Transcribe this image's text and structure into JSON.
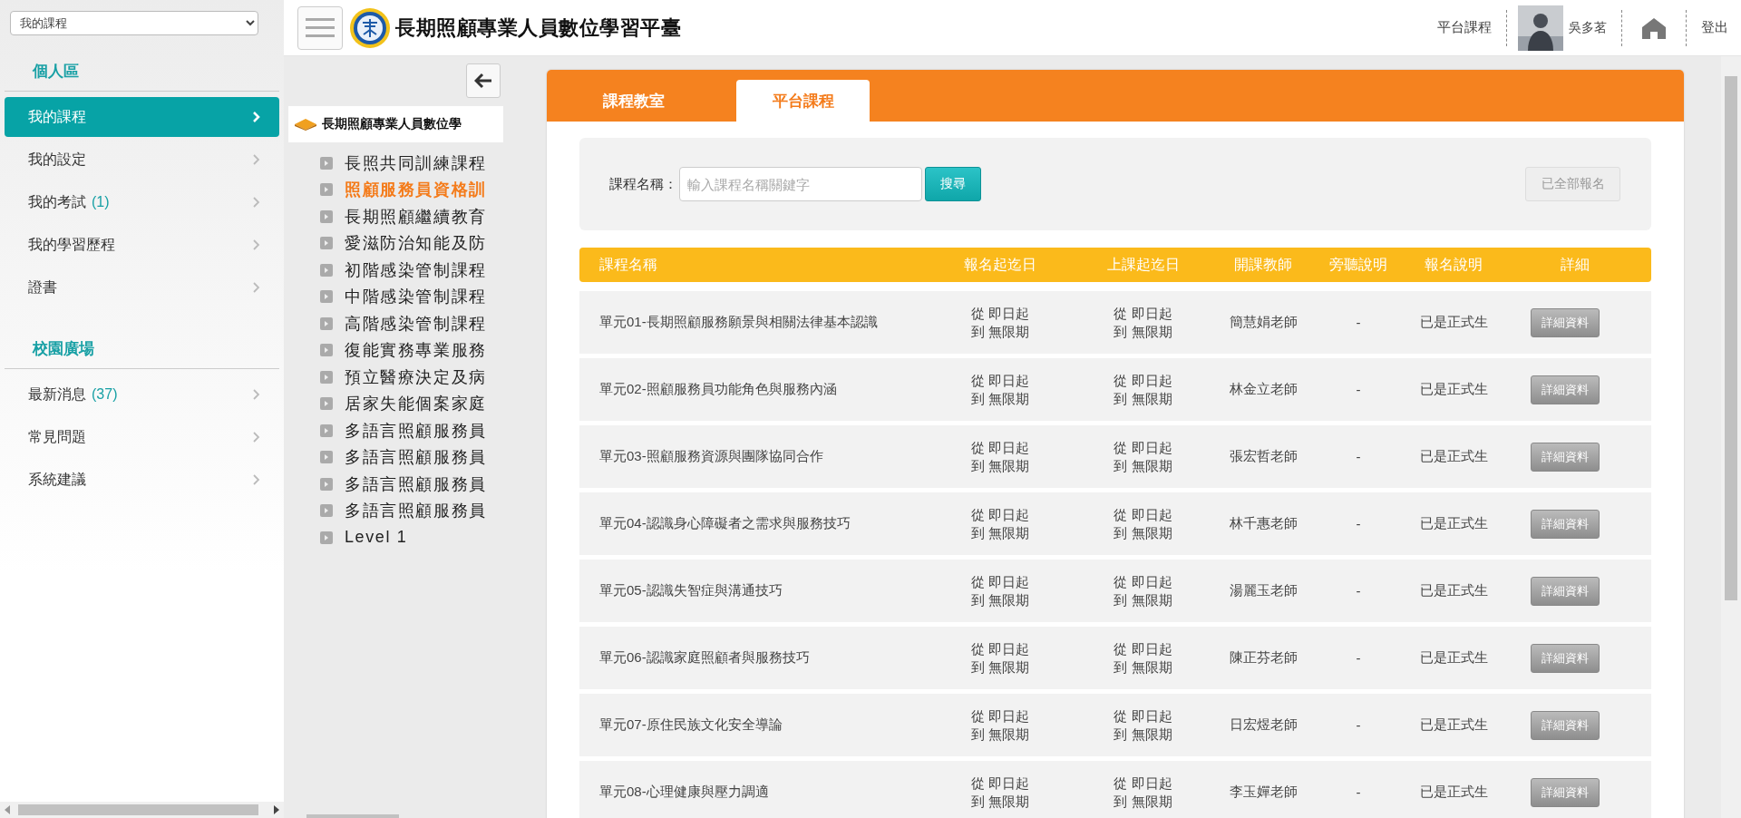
{
  "sidebar": {
    "select": {
      "value": "我的課程"
    },
    "sections": [
      {
        "title": "個人區",
        "items": [
          {
            "label": "我的課程",
            "selected": true
          },
          {
            "label": "我的設定",
            "selected": false
          },
          {
            "label": "我的考試",
            "count": "(1)",
            "selected": false
          },
          {
            "label": "我的學習歷程",
            "selected": false
          },
          {
            "label": "證書",
            "selected": false
          }
        ]
      },
      {
        "title": "校園廣場",
        "items": [
          {
            "label": "最新消息",
            "count": "(37)",
            "selected": false
          },
          {
            "label": "常見問題",
            "selected": false
          },
          {
            "label": "系統建議",
            "selected": false
          }
        ]
      }
    ]
  },
  "header": {
    "title": "長期照顧專業人員數位學習平臺",
    "links": [
      "平台課程"
    ],
    "user": "吳多茗",
    "logout": "登出"
  },
  "tree": {
    "root": {
      "label": "長期照顧專業人員數位學",
      "children": [
        {
          "label": "長照共同訓練課程",
          "selected": false
        },
        {
          "label": "照顧服務員資格訓",
          "selected": true
        },
        {
          "label": "長期照顧繼續教育",
          "selected": false
        },
        {
          "label": "愛滋防治知能及防",
          "selected": false
        },
        {
          "label": "初階感染管制課程",
          "selected": false
        },
        {
          "label": "中階感染管制課程",
          "selected": false
        },
        {
          "label": "高階感染管制課程",
          "selected": false
        },
        {
          "label": "復能實務專業服務",
          "selected": false
        },
        {
          "label": "預立醫療決定及病",
          "selected": false
        },
        {
          "label": "居家失能個案家庭",
          "selected": false
        },
        {
          "label": "多語言照顧服務員",
          "selected": false
        },
        {
          "label": "多語言照顧服務員",
          "selected": false
        },
        {
          "label": "多語言照顧服務員",
          "selected": false
        },
        {
          "label": "多語言照顧服務員",
          "selected": false
        },
        {
          "label": "Level 1",
          "selected": false
        }
      ]
    }
  },
  "tabs": [
    {
      "label": "課程教室",
      "selected": false
    },
    {
      "label": "平台課程",
      "selected": true
    }
  ],
  "search": {
    "label": "課程名稱：",
    "placeholder": "輸入課程名稱關鍵字",
    "button": "搜尋",
    "enroll_all": {
      "label": "已全部報名",
      "disabled": true
    }
  },
  "table": {
    "columns": [
      "課程名稱",
      "報名起迄日",
      "上課起迄日",
      "開課教師",
      "旁聽說明",
      "報名說明",
      "詳細"
    ],
    "rows": [
      {
        "name": "單元01-長期照顧服務願景與相關法律基本認識",
        "enroll": [
          "從 即日起",
          "到 無限期"
        ],
        "class": [
          "從 即日起",
          "到 無限期"
        ],
        "teacher": "簡慧娟老師",
        "audit": "-",
        "note": "已是正式生",
        "button": "詳細資料"
      },
      {
        "name": "單元02-照顧服務員功能角色與服務內涵",
        "enroll": [
          "從 即日起",
          "到 無限期"
        ],
        "class": [
          "從 即日起",
          "到 無限期"
        ],
        "teacher": "林金立老師",
        "audit": "-",
        "note": "已是正式生",
        "button": "詳細資料"
      },
      {
        "name": "單元03-照顧服務資源與團隊協同合作",
        "enroll": [
          "從 即日起",
          "到 無限期"
        ],
        "class": [
          "從 即日起",
          "到 無限期"
        ],
        "teacher": "張宏哲老師",
        "audit": "-",
        "note": "已是正式生",
        "button": "詳細資料"
      },
      {
        "name": "單元04-認識身心障礙者之需求與服務技巧",
        "enroll": [
          "從 即日起",
          "到 無限期"
        ],
        "class": [
          "從 即日起",
          "到 無限期"
        ],
        "teacher": "林千惠老師",
        "audit": "-",
        "note": "已是正式生",
        "button": "詳細資料"
      },
      {
        "name": "單元05-認識失智症與溝通技巧",
        "enroll": [
          "從 即日起",
          "到 無限期"
        ],
        "class": [
          "從 即日起",
          "到 無限期"
        ],
        "teacher": "湯麗玉老師",
        "audit": "-",
        "note": "已是正式生",
        "button": "詳細資料"
      },
      {
        "name": "單元06-認識家庭照顧者與服務技巧",
        "enroll": [
          "從 即日起",
          "到 無限期"
        ],
        "class": [
          "從 即日起",
          "到 無限期"
        ],
        "teacher": "陳正芬老師",
        "audit": "-",
        "note": "已是正式生",
        "button": "詳細資料"
      },
      {
        "name": "單元07-原住民族文化安全導論",
        "enroll": [
          "從 即日起",
          "到 無限期"
        ],
        "class": [
          "從 即日起",
          "到 無限期"
        ],
        "teacher": "日宏煜老師",
        "audit": "-",
        "note": "已是正式生",
        "button": "詳細資料"
      },
      {
        "name": "單元08-心理健康與壓力調適",
        "enroll": [
          "從 即日起",
          "到 無限期"
        ],
        "class": [
          "從 即日起",
          "到 無限期"
        ],
        "teacher": "李玉嬋老師",
        "audit": "-",
        "note": "已是正式生",
        "button": "詳細資料"
      }
    ]
  }
}
